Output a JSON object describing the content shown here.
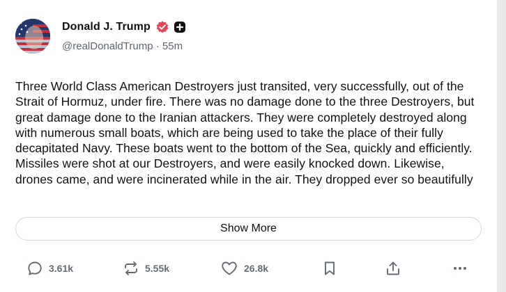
{
  "post": {
    "author": {
      "display_name": "Donald J. Trump",
      "handle": "@realDonaldTrump",
      "separator": "·",
      "time_ago": "55m",
      "verified_badge_color": "#e0455a",
      "plus_badge_color": "#111111"
    },
    "text": "Three World Class American Destroyers just transited, very successfully, out of the Strait of Hormuz, under fire. There was no damage done to the three Destroyers, but great damage done to the Iranian attackers. They were completely destroyed along with numerous small boats, which are being used to take the place of their fully decapitated Navy. These boats went to the bottom of the Sea, quickly and efficiently. Missiles were shot at our Destroyers, and were easily knocked down. Likewise, drones came, and were incinerated while in the air. They dropped ever so beautifully",
    "show_more_label": "Show More"
  },
  "actions": {
    "replies": {
      "count": "3.61k",
      "icon": "reply-icon"
    },
    "reposts": {
      "count": "5.55k",
      "icon": "repost-icon"
    },
    "likes": {
      "count": "26.8k",
      "icon": "like-icon"
    },
    "bookmark": {
      "icon": "bookmark-icon"
    },
    "share": {
      "icon": "share-icon"
    },
    "more": {
      "icon": "more-icon"
    }
  }
}
